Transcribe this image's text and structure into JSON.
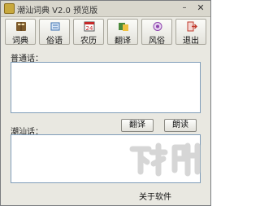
{
  "window": {
    "title": "潮汕词典 V2.0 预览版",
    "minimize_glyph": "–",
    "close_glyph": "✕"
  },
  "toolbar": {
    "items": [
      {
        "label": "词典",
        "icon": "book-icon",
        "color": "#7d5a2c"
      },
      {
        "label": "俗语",
        "icon": "scroll-icon",
        "color": "#3a6fb0"
      },
      {
        "label": "农历",
        "icon": "calendar-icon",
        "color": "#c62828",
        "icon_text": "24"
      },
      {
        "label": "翻译",
        "icon": "translate-icon",
        "color": "#4a8a3a"
      },
      {
        "label": "风俗",
        "icon": "culture-icon",
        "color": "#8e44ad"
      },
      {
        "label": "退出",
        "icon": "exit-icon",
        "color": "#c0392b"
      }
    ]
  },
  "mandarin": {
    "label": "普通话：",
    "value": ""
  },
  "chaoshan": {
    "label": "潮汕话：",
    "value": ""
  },
  "buttons": {
    "translate": "翻译",
    "read": "朗读",
    "about": "关于软件"
  },
  "watermark": {
    "text": "下载吧"
  }
}
